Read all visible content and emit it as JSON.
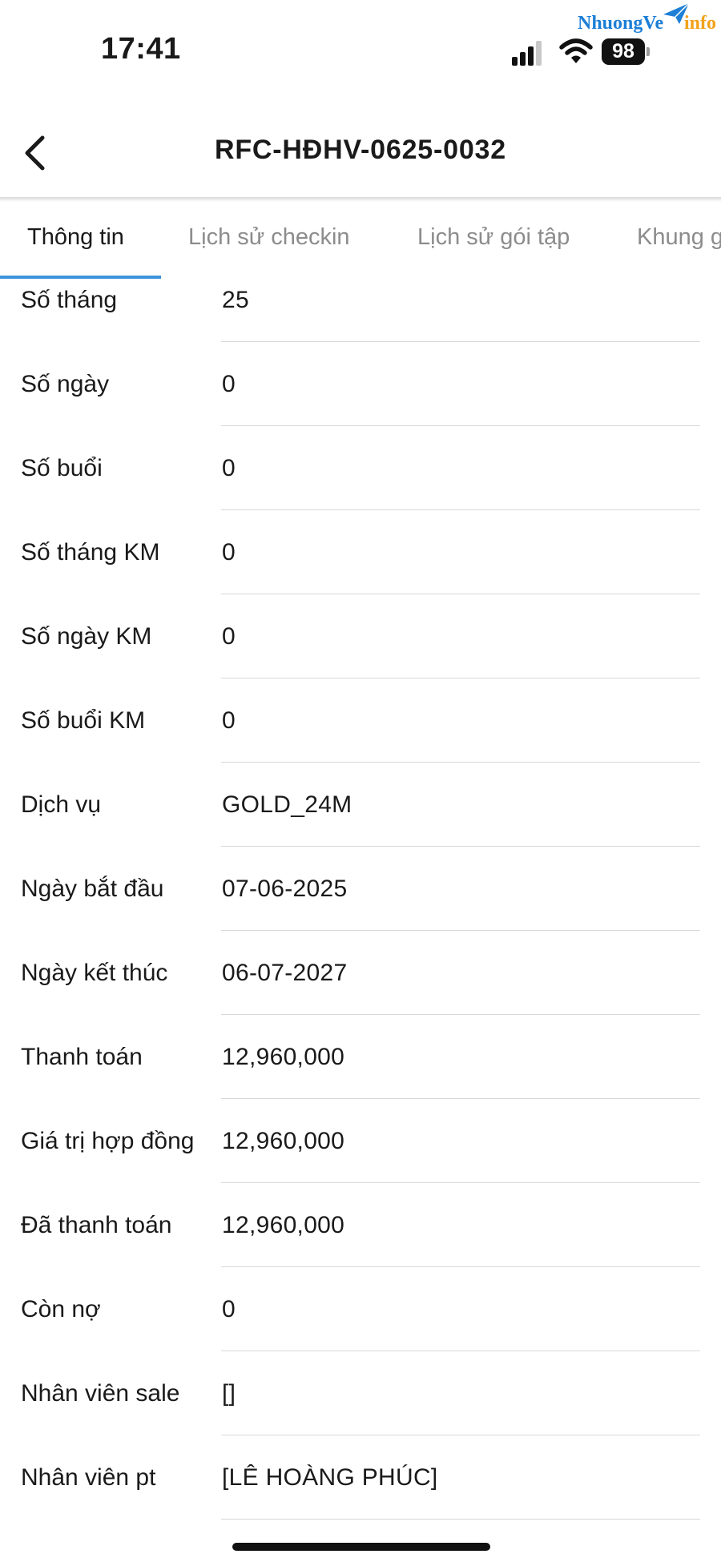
{
  "status_bar": {
    "time": "17:41",
    "battery": "98",
    "icons": [
      "signal-icon",
      "wifi-icon",
      "battery-icon"
    ]
  },
  "watermark": {
    "text_main": "NhuongVe",
    "text_suffix": "info",
    "colors": {
      "main": "#1d7fd6",
      "suffix": "#f2a21b"
    }
  },
  "header": {
    "title": "RFC-HĐHV-0625-0032",
    "back_icon": "chevron-left-icon"
  },
  "tabs": [
    {
      "label": "Thông tin",
      "active": true
    },
    {
      "label": "Lịch sử checkin",
      "active": false
    },
    {
      "label": "Lịch sử gói tập",
      "active": false
    },
    {
      "label": "Khung g",
      "active": false
    }
  ],
  "details": [
    {
      "label": "Số tháng",
      "value": "25"
    },
    {
      "label": "Số ngày",
      "value": "0"
    },
    {
      "label": "Số buổi",
      "value": "0"
    },
    {
      "label": "Số tháng KM",
      "value": "0"
    },
    {
      "label": "Số ngày KM",
      "value": "0"
    },
    {
      "label": "Số buổi KM",
      "value": "0"
    },
    {
      "label": "Dịch vụ",
      "value": "GOLD_24M"
    },
    {
      "label": "Ngày bắt đầu",
      "value": "07-06-2025"
    },
    {
      "label": "Ngày kết thúc",
      "value": "06-07-2027"
    },
    {
      "label": "Thanh toán",
      "value": "12,960,000"
    },
    {
      "label": "Giá trị hợp đồng",
      "value": "12,960,000"
    },
    {
      "label": "Đã thanh toán",
      "value": "12,960,000"
    },
    {
      "label": "Còn nợ",
      "value": "0"
    },
    {
      "label": "Nhân viên sale",
      "value": "[]"
    },
    {
      "label": "Nhân viên pt",
      "value": "[LÊ HOÀNG PHÚC]"
    }
  ],
  "colors": {
    "accent": "#3d93dc",
    "divider": "#d8d8d8",
    "inactive_tab": "#8c8c8c"
  }
}
